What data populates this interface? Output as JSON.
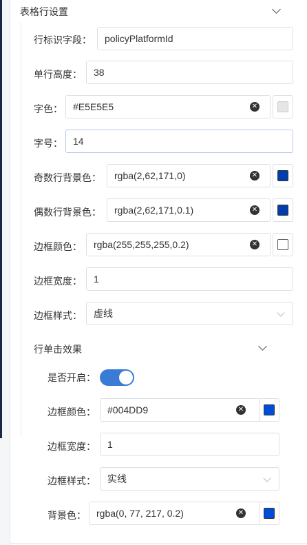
{
  "section": {
    "title": "表格行设置"
  },
  "fields": {
    "row_id_field": {
      "label": "行标识字段：",
      "value": "policyPlatformId"
    },
    "row_height": {
      "label": "单行高度：",
      "value": "38"
    },
    "font_color": {
      "label": "字色：",
      "value": "#E5E5E5",
      "swatch": "#E5E5E5"
    },
    "font_size": {
      "label": "字号：",
      "value": "14"
    },
    "odd_row_bg": {
      "label": "奇数行背景色：",
      "value": "rgba(2,62,171,0)",
      "swatch": "#023EAB"
    },
    "even_row_bg": {
      "label": "偶数行背景色：",
      "value": "rgba(2,62,171,0.1)",
      "swatch": "#023EAB"
    },
    "border_color": {
      "label": "边框颜色：",
      "value": "rgba(255,255,255,0.2)",
      "swatch": "#FFFFFF"
    },
    "border_width": {
      "label": "边框宽度：",
      "value": "1"
    },
    "border_style": {
      "label": "边框样式：",
      "value": "虚线"
    }
  },
  "click_effect": {
    "title": "行单击效果",
    "enabled": {
      "label": "是否开启：",
      "on": true
    },
    "border_color": {
      "label": "边框颜色：",
      "value": "#004DD9",
      "swatch": "#004DD9"
    },
    "border_width": {
      "label": "边框宽度：",
      "value": "1"
    },
    "border_style": {
      "label": "边框样式：",
      "value": "实线"
    },
    "bg_color": {
      "label": "背景色：",
      "value": "rgba(0, 77, 217, 0.2)",
      "swatch": "#004DD9"
    }
  }
}
